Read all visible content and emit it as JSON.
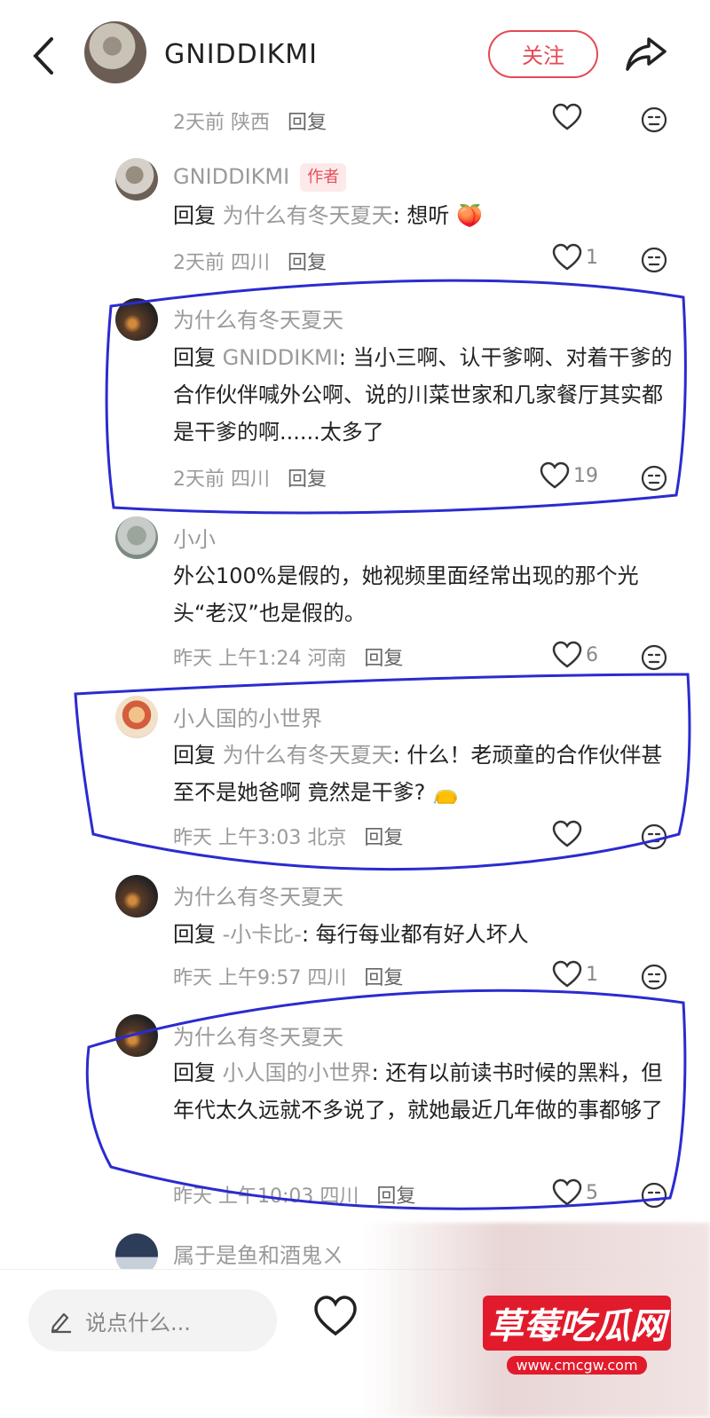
{
  "header": {
    "user_name": "GNIDDIKMI",
    "follow_label": "关注"
  },
  "comments": [
    {
      "meta": "2天前 陕西",
      "reply": "回复",
      "likes": ""
    },
    {
      "name": "GNIDDIKMI",
      "badge": "作者",
      "prefix": "回复",
      "target": "为什么有冬天夏天",
      "text": ": 想听",
      "meta": "2天前 四川",
      "reply": "回复",
      "likes": "1"
    },
    {
      "name": "为什么有冬天夏天",
      "prefix": "回复",
      "target": "GNIDDIKMI",
      "text": ": 当小三啊、认干爹啊、对着干爹的合作伙伴喊外公啊、说的川菜世家和几家餐厅其实都是干爹的啊......太多了",
      "meta": "2天前 四川",
      "reply": "回复",
      "likes": "19"
    },
    {
      "name": "小小",
      "text": "外公100%是假的，她视频里面经常出现的那个光头“老汉”也是假的。",
      "meta": "昨天 上午1:24 河南",
      "reply": "回复",
      "likes": "6"
    },
    {
      "name": "小人国的小世界",
      "prefix": "回复",
      "target": "为什么有冬天夏天",
      "text": ": 什么！老顽童的合作伙伴甚至不是她爸啊 竟然是干爹?",
      "meta": "昨天 上午3:03 北京",
      "reply": "回复",
      "likes": ""
    },
    {
      "name": "为什么有冬天夏天",
      "prefix": "回复",
      "target": "-小卡比-",
      "text": ": 每行每业都有好人坏人",
      "meta": "昨天 上午9:57 四川",
      "reply": "回复",
      "likes": "1"
    },
    {
      "name": "为什么有冬天夏天",
      "prefix": "回复",
      "target": "小人国的小世界",
      "text": ": 还有以前读书时候的黑料，但年代太久远就不多说了，就她最近几年做的事都够了",
      "meta": "昨天 上午10:03 四川",
      "reply": "回复",
      "likes": "5"
    },
    {
      "name": "属于是鱼和酒鬼ㄨ"
    }
  ],
  "bottom": {
    "input_placeholder": "说点什么..."
  },
  "watermark": {
    "title": "草莓吃瓜网",
    "url": "www.cmcgw.com"
  },
  "icons": {
    "back": "chevron-left-icon",
    "share": "share-arrow-icon",
    "like": "heart-outline-icon",
    "dislike": "neutral-face-icon",
    "edit": "pencil-icon"
  },
  "colors": {
    "accent": "#e34a55",
    "annotation_ink": "#2b2bd0"
  }
}
